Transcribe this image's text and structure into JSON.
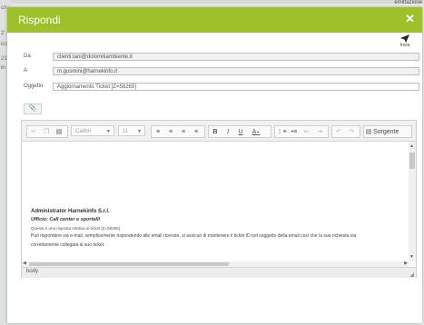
{
  "background": {
    "left_fragments": [
      "cri",
      "2'",
      "icc",
      "21",
      "in"
    ],
    "top_right": "emittazione"
  },
  "dialog": {
    "title": "Rispondi",
    "close_glyph": "✕",
    "send_label": "Invia",
    "accent_color": "#9ec12b"
  },
  "form": {
    "from_label": "Da",
    "from_value": "clienti.tani@dolomitiambiente.it",
    "to_label": "A",
    "to_value": "m.gusmini@harnekinfo.it",
    "subject_label": "Oggetto",
    "subject_value": "Aggiornamento Ticket [Z=58265]"
  },
  "toolbar": {
    "font_name": "Calibri",
    "font_size": "11",
    "bold": "B",
    "italic": "I",
    "underline": "U",
    "font_color": "A",
    "source_label": "Sorgente"
  },
  "content": {
    "name": "Administrator Harnekinfo S.r.l.",
    "office": "Ufficio: Call center e sportelli",
    "note": "Questa è una risposta relativa al ticket [Z=58265]",
    "body1": "Può rispondere via e-mail, semplicemente rispondendo alle email ricevute, si assicuri di mantenere il ticket ID nel soggetto della email così che la sua richiesta sia",
    "body2": "correttamente collegata al suo ticket."
  },
  "statusbar": {
    "path": "body"
  }
}
